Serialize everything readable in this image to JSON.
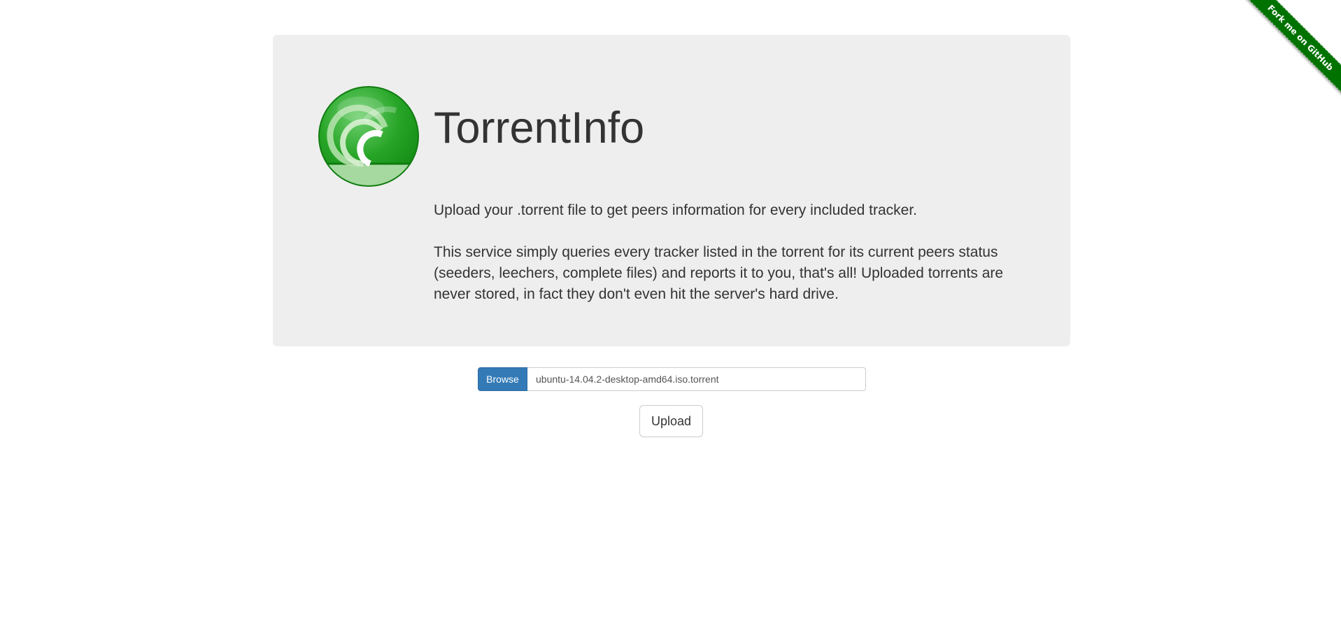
{
  "header": {
    "title": "TorrentInfo",
    "logo_icon": "torrent-logo-icon"
  },
  "intro": {
    "line1": "Upload your .torrent file to get peers information for every included tracker.",
    "line2": "This service simply queries every tracker listed in the torrent for its current peers status (seeders, leechers, complete files) and reports it to you, that's all! Uploaded torrents are never stored, in fact they don't even hit the server's hard drive."
  },
  "form": {
    "browse_label": "Browse",
    "file_name": "ubuntu-14.04.2-desktop-amd64.iso.torrent",
    "upload_label": "Upload"
  },
  "ribbon": {
    "label": "Fork me on GitHub"
  },
  "colors": {
    "jumbotron_bg": "#eeeeee",
    "primary": "#337ab7",
    "ribbon": "#007200",
    "logo_green": "#1a9a1a"
  }
}
